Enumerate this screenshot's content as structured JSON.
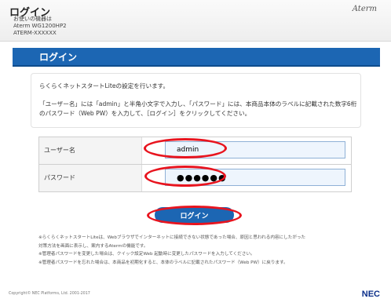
{
  "header": {
    "title": "ログイン",
    "device_line1": "お使いの機器は",
    "device_line2": "Aterm WG1200HP2",
    "device_line3": "ATERM-XXXXXX",
    "brand": "Aterm"
  },
  "section": {
    "title": "ログイン"
  },
  "info": {
    "line1": "らくらくネットスタートLiteの設定を行います。",
    "line2": "「ユーザー名」には「admin」と半角小文字で入力し、「パスワード」には、本商品本体のラベルに記載された数字6桁のパスワード（Web PW）を入力して、［ログイン］をクリックしてください。"
  },
  "form": {
    "username_label": "ユーザー名",
    "username_value": "admin",
    "password_label": "パスワード",
    "password_value": "●●●●●●"
  },
  "login_button": "ログイン",
  "notes": [
    "※らくらくネットスタートLiteは、Webブラウザでインターネットに接続できない状態であった場合、原因と思われる内容にしたがった",
    "対策方法を画面に表示し、案内するAtermの機能です。",
    "※管理者パスワードを変更した場合は、クイック設定Web 起動時に変更したパスワードを入力してください。",
    "※管理者パスワードを忘れた場合は、本商品を初期化すると、本体のラベルに記載されたパスワード（Web PW）に戻ります。"
  ],
  "footer": {
    "copyright": "Copyright© NEC Platforms, Ltd. 2001-2017",
    "logo": "NEC"
  },
  "colors": {
    "accent": "#1c66b3",
    "highlight": "#e8141e",
    "input_bg": "#eef5fd"
  }
}
